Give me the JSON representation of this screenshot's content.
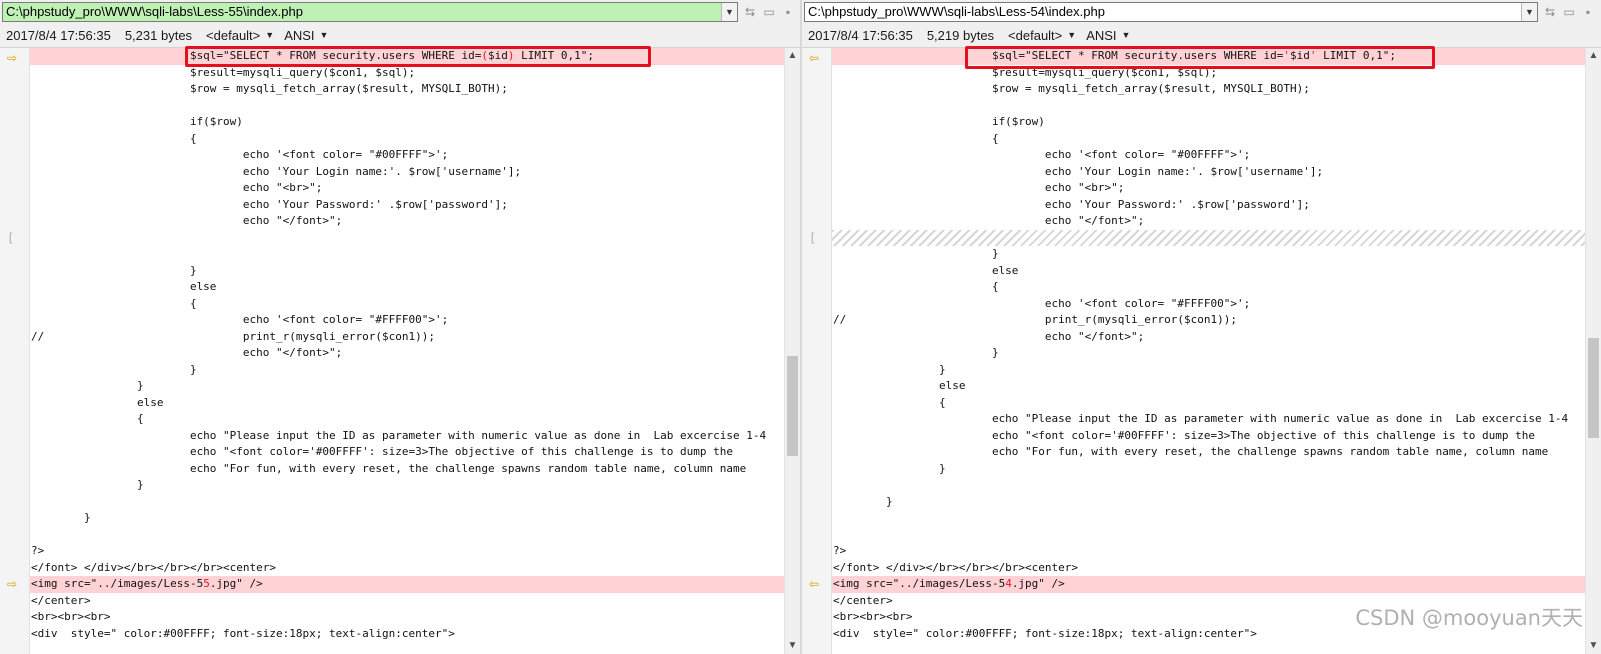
{
  "left": {
    "path": "C:\\phpstudy_pro\\WWW\\sqli-labs\\Less-55\\index.php",
    "info": {
      "datetime": "2017/8/4 17:56:35",
      "size": "5,231 bytes",
      "encoding_profile": "<default>",
      "charset": "ANSI"
    },
    "lines": [
      "                        $sql=\"SELECT * FROM security.users WHERE id=($id) LIMIT 0,1\";",
      "                        $result=mysqli_query($con1, $sql);",
      "                        $row = mysqli_fetch_array($result, MYSQLI_BOTH);",
      "",
      "                        if($row)",
      "                        {",
      "                                echo '<font color= \"#00FFFF\">';",
      "                                echo 'Your Login name:'. $row['username'];",
      "                                echo \"<br>\";",
      "                                echo 'Your Password:' .$row['password'];",
      "                                echo \"</font>\";",
      "",
      "",
      "                        }",
      "                        else",
      "                        {",
      "                                echo '<font color= \"#FFFF00\">';",
      "//                              print_r(mysqli_error($con1));",
      "                                echo \"</font>\";",
      "                        }",
      "                }",
      "                else",
      "                {",
      "                        echo \"Please input the ID as parameter with numeric value as done in  Lab excercise 1-4",
      "                        echo \"<font color='#00FFFF': size=3>The objective of this challenge is to dump the",
      "                        echo \"For fun, with every reset, the challenge spawns random table name, column name",
      "                }",
      "",
      "        }",
      "",
      "",
      "?>",
      "</font> </div></br></br></br><center>",
      "<img src=\"../images/Less-55.jpg\" />",
      "</center>",
      "<br><br><br>",
      "<div  style=\" color:#00FFFF; font-size:18px; text-align:center\">"
    ]
  },
  "right": {
    "path": "C:\\phpstudy_pro\\WWW\\sqli-labs\\Less-54\\index.php",
    "info": {
      "datetime": "2017/8/4 17:56:35",
      "size": "5,219 bytes",
      "encoding_profile": "<default>",
      "charset": "ANSI"
    },
    "lines": [
      "                        $sql=\"SELECT * FROM security.users WHERE id='$id' LIMIT 0,1\";",
      "                        $result=mysqli_query($con1, $sql);",
      "                        $row = mysqli_fetch_array($result, MYSQLI_BOTH);",
      "",
      "                        if($row)",
      "                        {",
      "                                echo '<font color= \"#00FFFF\">';",
      "                                echo 'Your Login name:'. $row['username'];",
      "                                echo \"<br>\";",
      "                                echo 'Your Password:' .$row['password'];",
      "                                echo \"</font>\";",
      "",
      "",
      "                        }",
      "                        else",
      "                        {",
      "                                echo '<font color= \"#FFFF00\">';",
      "//                              print_r(mysqli_error($con1));",
      "                                echo \"</font>\";",
      "                        }",
      "                }",
      "                else",
      "                {",
      "                        echo \"Please input the ID as parameter with numeric value as done in  Lab excercise 1-4",
      "                        echo \"<font color='#00FFFF': size=3>The objective of this challenge is to dump the",
      "                        echo \"For fun, with every reset, the challenge spawns random table name, column name",
      "                }",
      "",
      "        }",
      "",
      "",
      "?>",
      "</font> </div></br></br></br><center>",
      "<img src=\"../images/Less-54.jpg\" />",
      "</center>",
      "<br><br><br>",
      "<div  style=\" color:#00FFFF; font-size:18px; text-align:center\">"
    ]
  },
  "watermark": "CSDN @mooyuan天天"
}
